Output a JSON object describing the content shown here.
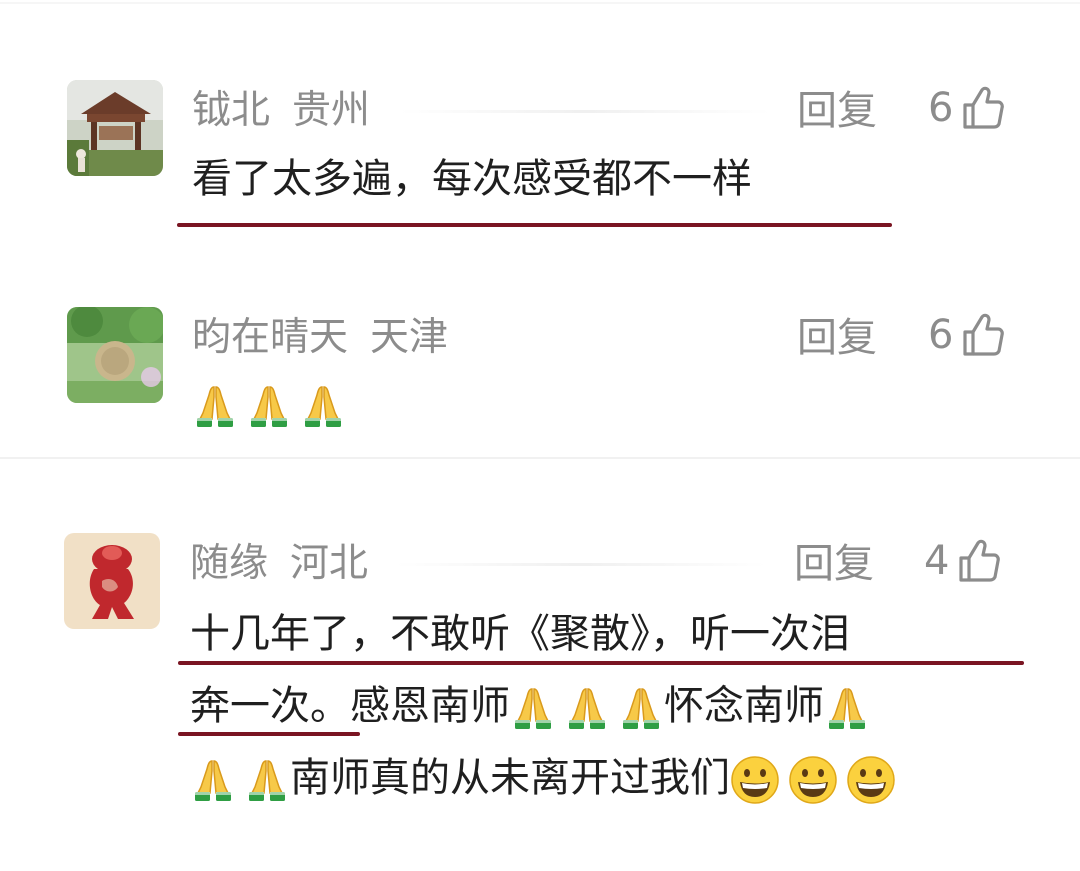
{
  "comments": [
    {
      "username": "钺北",
      "location": "贵州",
      "reply_label": "回复",
      "like_count": "6",
      "text": "看了太多遍，每次感受都不一样",
      "avatar_icon": "pavilion-photo-avatar"
    },
    {
      "username": "昀在晴天",
      "location": "天津",
      "reply_label": "回复",
      "like_count": "6",
      "emojis": [
        "folded-hands-icon",
        "folded-hands-icon",
        "folded-hands-icon"
      ],
      "avatar_icon": "garden-photo-avatar"
    },
    {
      "username": "随缘",
      "location": "河北",
      "reply_label": "回复",
      "like_count": "4",
      "line1": "十几年了，不敢听《聚散》，听一次泪",
      "line2_a": "奔一次。感恩南师",
      "line2_b": "怀念南师",
      "line3": "南师真的从未离开过我们",
      "avatar_icon": "red-seal-avatar"
    }
  ],
  "colors": {
    "meta_text": "#8c8c8c",
    "body_text": "#1f1f1f",
    "underline": "#7a1522"
  }
}
